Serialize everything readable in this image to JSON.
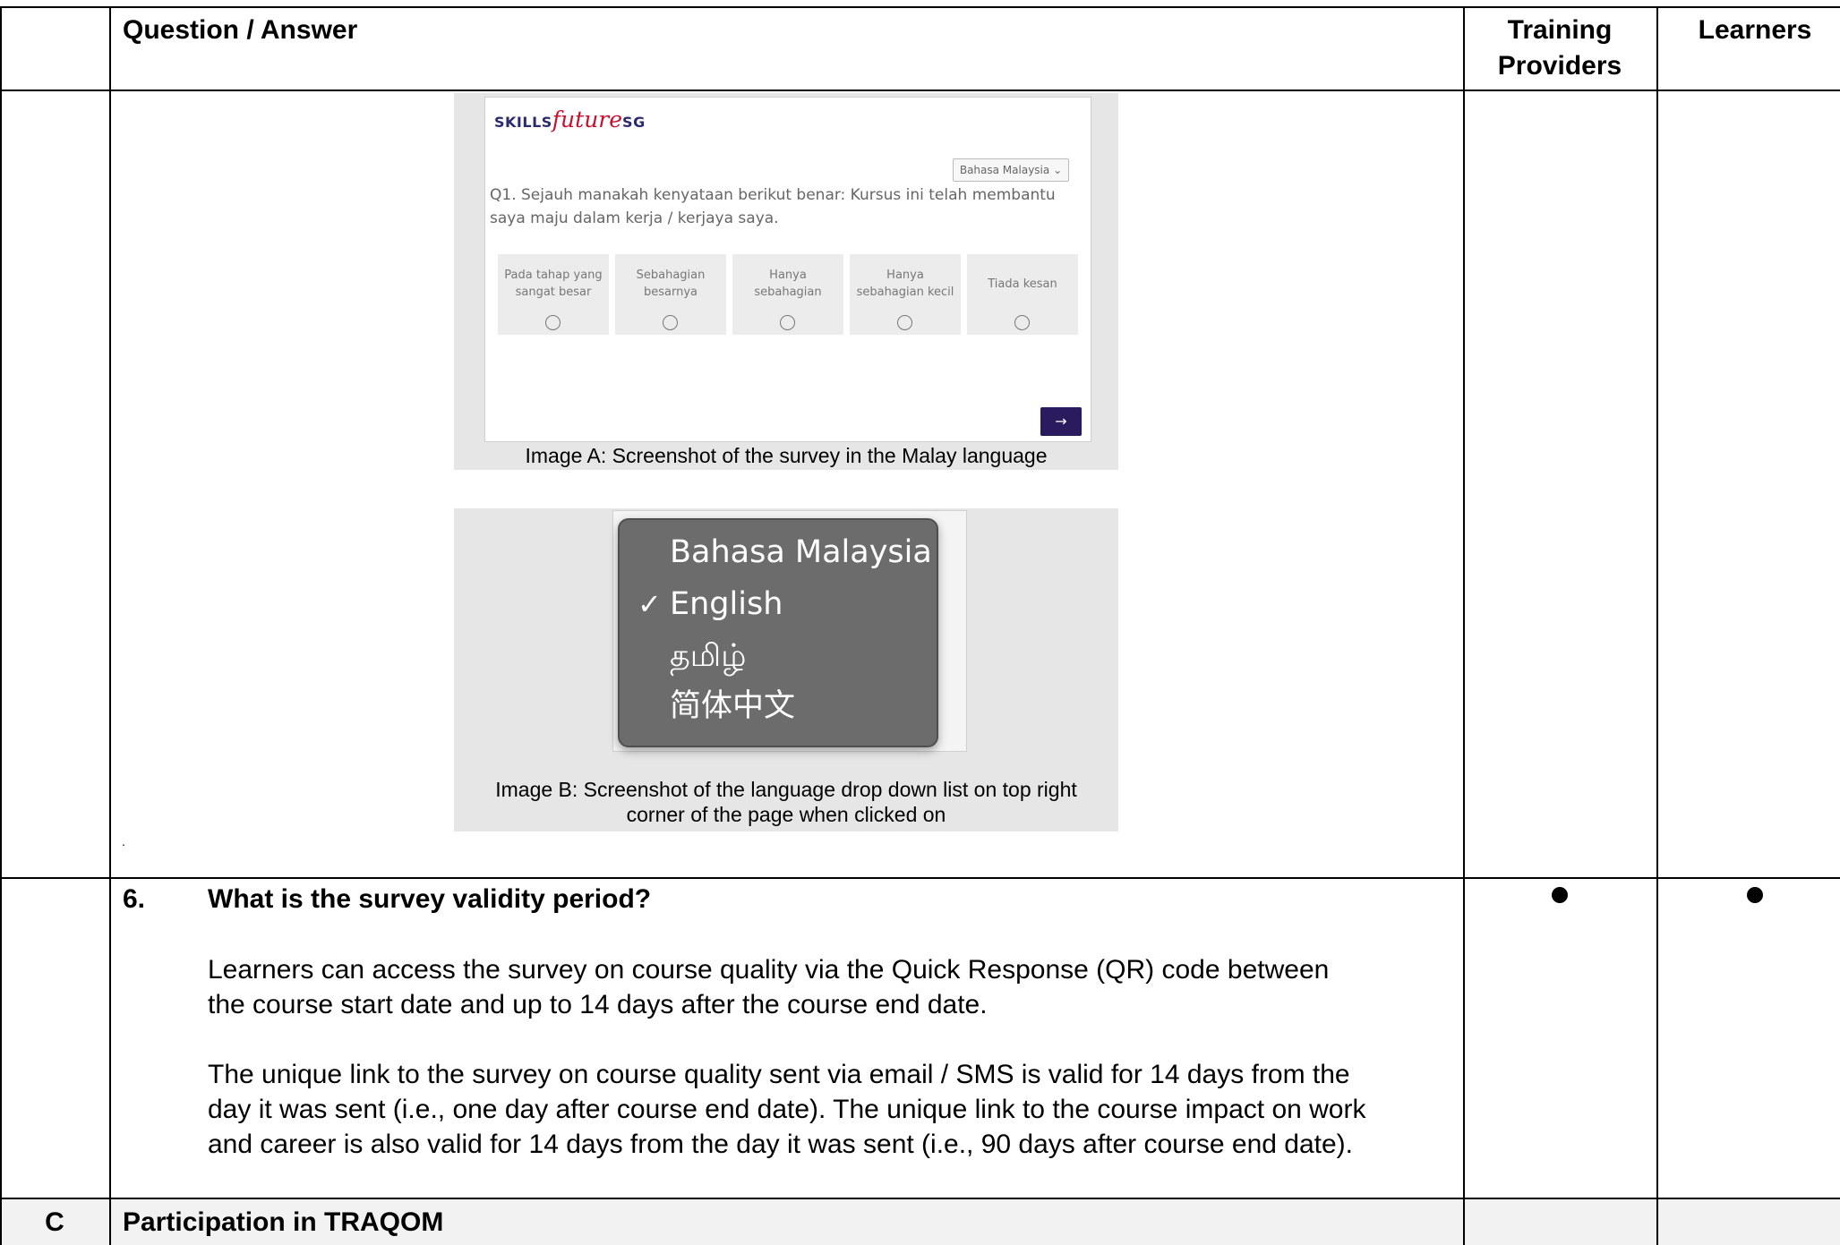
{
  "header": {
    "col_question": "Question / Answer",
    "col_training": "Training Providers",
    "col_learners": "Learners"
  },
  "image_a": {
    "logo": {
      "part1": "SKILLS",
      "part2": "future",
      "part3": "SG"
    },
    "language_select": "Bahasa Malaysia",
    "question": "Q1. Sejauh manakah kenyataan berikut benar: Kursus ini telah membantu saya maju dalam kerja / kerjaya saya.",
    "options": [
      "Pada tahap yang sangat besar",
      "Sebahagian besarnya",
      "Hanya sebahagian",
      "Hanya sebahagian kecil",
      "Tiada kesan"
    ],
    "next_label": "→",
    "caption": "Image A: Screenshot of the survey in the Malay language"
  },
  "image_b": {
    "languages": [
      {
        "label": "Bahasa Malaysia",
        "check": ""
      },
      {
        "label": "English",
        "check": "✓"
      },
      {
        "label": "தமிழ்",
        "check": ""
      },
      {
        "label": "简体中文",
        "check": ""
      }
    ],
    "caption_line1": "Image B: Screenshot of the language drop down list on top right",
    "caption_line2": "corner of the page when clicked on"
  },
  "stray_mark": ".",
  "question6": {
    "number": "6.",
    "title": "What is the survey validity period?",
    "para1_line1": "Learners can access the survey on course quality via the Quick Response (QR) code between",
    "para1_line2": "the course start date and up to 14 days after the course end date.",
    "para2_line1": "The unique link to the survey on course quality sent via email / SMS is valid for 14 days from the",
    "para2_line2": "day it was sent (i.e., one day after course end date). The unique link to the course impact on work",
    "para2_line3": "and career is also valid for 14 days from the day it was sent (i.e., 90 days after course end date).",
    "training_providers": true,
    "learners": true
  },
  "section_c": {
    "letter": "C",
    "title": "Participation in TRAQOM"
  }
}
